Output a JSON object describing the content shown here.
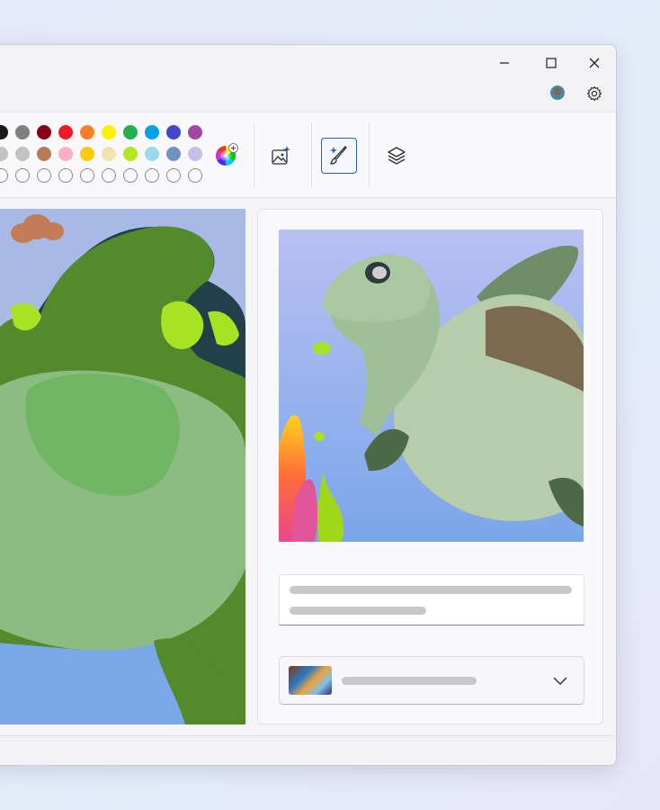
{
  "window": {
    "controls": {
      "minimize": "minimize-icon",
      "maximize": "maximize-icon",
      "close": "close-icon"
    },
    "account_avatar": "avatar",
    "settings_icon": "gear-icon"
  },
  "palette": {
    "row1": [
      "#1a1a1a",
      "#7f7f7f",
      "#880015",
      "#ed1c24",
      "#ff7f27",
      "#fff200",
      "#22b14c",
      "#00a2e8",
      "#3f48cc",
      "#a349a4"
    ],
    "row2": [
      "#c3c3c3",
      "#c3c3c3",
      "#b97a57",
      "#ffaec9",
      "#ffc90e",
      "#efe4b0",
      "#b5e61d",
      "#99d9ea",
      "#7092be",
      "#c8bfe7"
    ],
    "row3_empty_count": 10,
    "color_picker_icon": "color-wheel-icon"
  },
  "tools": [
    "image-creator-icon",
    "cocreator-brush-icon",
    "layers-icon"
  ],
  "colors": {
    "accent": "#2b5ea8"
  }
}
